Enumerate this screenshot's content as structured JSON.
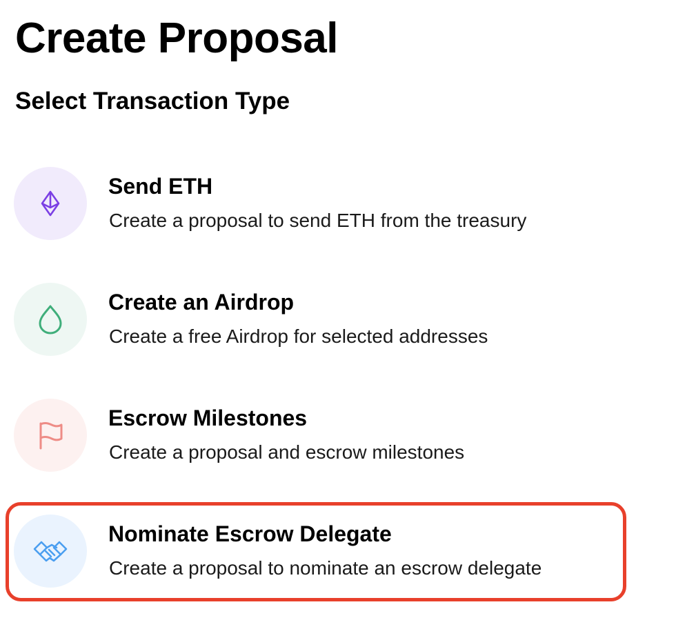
{
  "page": {
    "title": "Create Proposal",
    "subtitle": "Select Transaction Type"
  },
  "options": [
    {
      "title": "Send ETH",
      "description": "Create a proposal to send ETH from the treasury",
      "icon": "ethereum-icon",
      "icon_color": "#7b3fe4",
      "icon_bg": "#f1ebfc"
    },
    {
      "title": "Create an Airdrop",
      "description": "Create a free Airdrop for selected addresses",
      "icon": "droplet-icon",
      "icon_color": "#3fae7a",
      "icon_bg": "#eef7f3"
    },
    {
      "title": "Escrow Milestones",
      "description": "Create a proposal and escrow milestones",
      "icon": "flag-icon",
      "icon_color": "#ee8c86",
      "icon_bg": "#fdf1f0"
    },
    {
      "title": "Nominate Escrow Delegate",
      "description": "Create a proposal to nominate an escrow delegate",
      "icon": "handshake-icon",
      "icon_color": "#4a9ef0",
      "icon_bg": "#eaf3fe"
    }
  ],
  "highlight_color": "#e8402b"
}
